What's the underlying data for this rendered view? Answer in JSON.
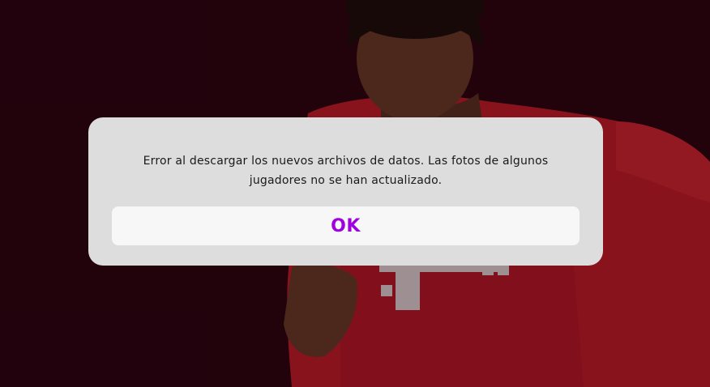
{
  "dialog": {
    "message_line1": "Error al descargar los nuevos archivos de datos. Las fotos de algunos",
    "message_line2": "jugadores no se han actualizado.",
    "ok_label": "OK"
  },
  "colors": {
    "background": "#2a0510",
    "dialog": "#dddddd",
    "button": "#f7f7f7",
    "ok_text": "#a000e0",
    "jersey": "#d3212c"
  },
  "background_image": {
    "icon": "football-player-photo"
  }
}
